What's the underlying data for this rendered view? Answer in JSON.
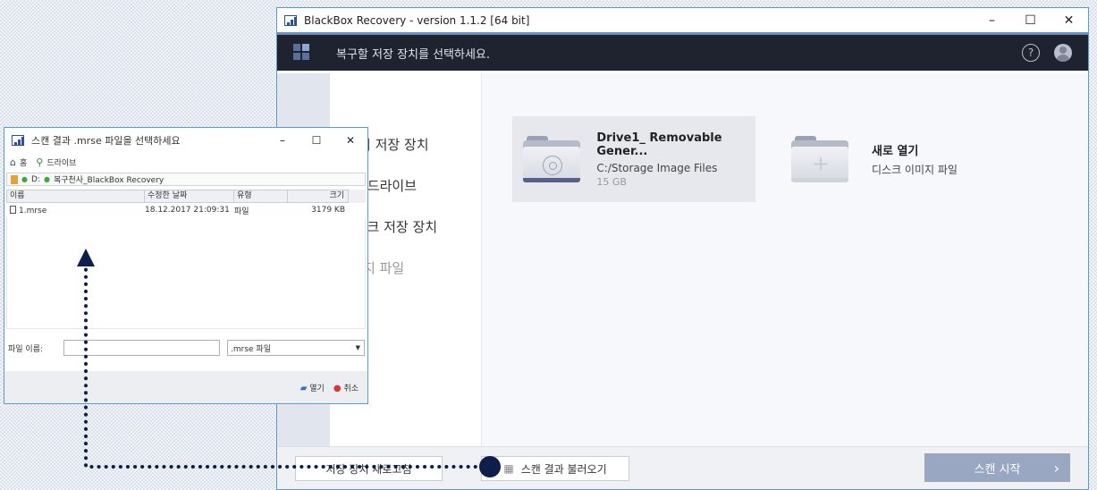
{
  "main_window": {
    "title": "BlackBox Recovery - version 1.1.2 [64 bit]",
    "minimize": "–",
    "maximize": "☐",
    "close": "✕",
    "header_title": "복구할 저장 장치를 선택하세요.",
    "help_symbol": "?",
    "nav_items": [
      "리 저장 장치",
      "| 드라이브",
      "∴크 저장 장치",
      "|지 파일"
    ],
    "drive_card": {
      "title": "Drive1_ Removable Gener...",
      "subtitle": "C:/Storage Image Files",
      "size": "15 GB"
    },
    "new_open_card": {
      "title": "새로 열기",
      "subtitle": "디스크 이미지 파일"
    },
    "footer": {
      "refresh_label": "저장 장치 새로고침",
      "load_scan_label": "스캔 결과 불러오기",
      "start_scan_label": "스캔 시작",
      "start_chevron": "›"
    }
  },
  "dialog": {
    "title": "스캔 결과 .mrse 파일을 선택하세요",
    "minimize": "–",
    "maximize": "☐",
    "close": "✕",
    "toolbar": {
      "home": "홈",
      "drive": "드라이브"
    },
    "path": {
      "drive": "D:",
      "folder": "복구천사_BlackBox Recovery"
    },
    "columns": [
      "이름",
      "수정한 날짜",
      "유형",
      "크기"
    ],
    "rows": [
      {
        "name": "1.mrse",
        "date": "18.12.2017 21:09:31",
        "type": "파일",
        "size": "3179 KB"
      }
    ],
    "filename_label": "파일 이름:",
    "filename_value": "",
    "filetype": ".mrse 파일",
    "open_label": "열기",
    "cancel_label": "취소"
  },
  "colors": {
    "header_bg": "#1f2330",
    "accent": "#5b9bd5",
    "annotation": "#0e1e4a",
    "start_button": "#9aa7c2"
  }
}
